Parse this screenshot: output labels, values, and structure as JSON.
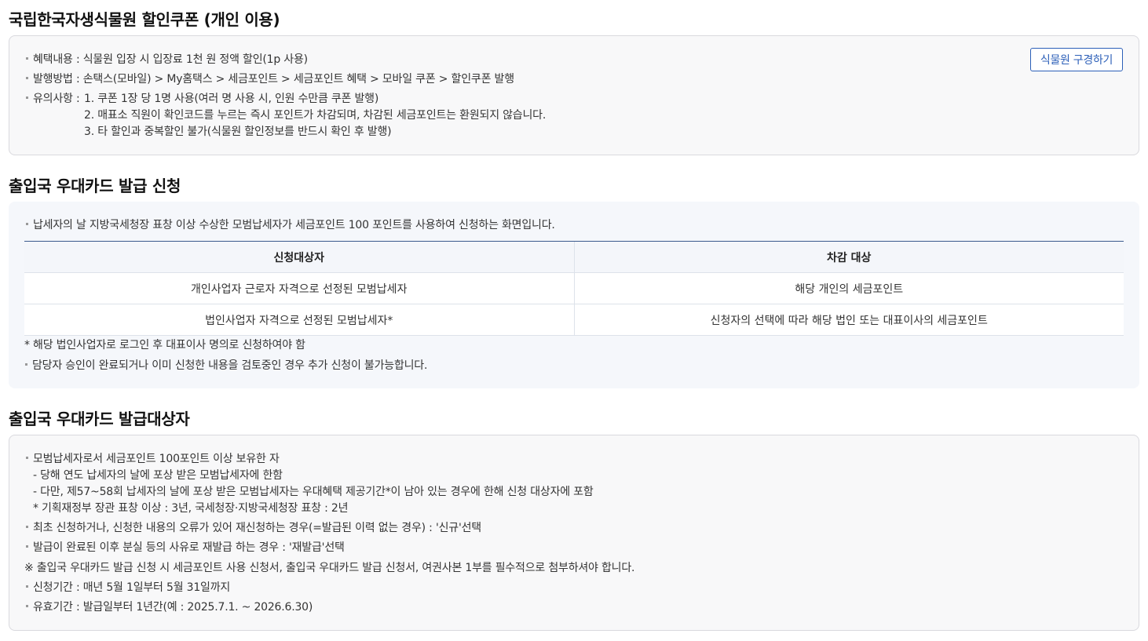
{
  "section1": {
    "title": "국립한국자생식물원 할인쿠폰 (개인 이용)",
    "button_label": "식물원 구경하기",
    "benefit": "혜택내용 : 식물원 입장 시 입장료 1천 원 정액 할인(1p 사용)",
    "issue_method": "발행방법 : 손택스(모바일) > My홈택스 > 세금포인트 > 세금포인트 혜택 > 모바일 쿠폰 > 할인쿠폰 발행",
    "caution_label": "유의사항 : ",
    "caution_items": [
      "1. 쿠폰 1장 당 1명 사용(여러 명 사용 시, 인원 수만큼 쿠폰 발행)",
      "2. 매표소 직원이 확인코드를 누르는 즉시 포인트가 차감되며, 차감된 세금포인트는 환원되지 않습니다.",
      "3. 타 할인과 중복할인 불가(식물원 할인정보를 반드시 확인 후 발행)"
    ]
  },
  "section2": {
    "title": "출입국 우대카드 발급 신청",
    "intro": "납세자의 날 지방국세청장 표창 이상 수상한 모범납세자가 세금포인트 100 포인트를 사용하여 신청하는 화면입니다.",
    "table": {
      "headers": [
        "신청대상자",
        "차감 대상"
      ],
      "rows": [
        [
          "개인사업자 근로자 자격으로 선정된 모범납세자",
          "해당 개인의 세금포인트"
        ],
        [
          "법인사업자 자격으로 선정된 모범납세자*",
          "신청자의 선택에 따라 해당 법인 또는 대표이사의 세금포인트"
        ]
      ]
    },
    "footnote": "* 해당 법인사업자로 로그인 후 대표이사 명의로 신청하여야 함",
    "note": "담당자 승인이 완료되거나 이미 신청한 내용을 검토중인 경우 추가 신청이 불가능합니다."
  },
  "section3": {
    "title": "출입국 우대카드 발급대상자",
    "items": [
      "모범납세자로서 세금포인트 100포인트 이상 보유한 자",
      "- 당해 연도 납세자의 날에 포상 받은 모범납세자에 한함",
      "- 다만, 제57~58회 납세자의 날에 포상 받은 모범납세자는 우대혜택 제공기간*이 남아 있는 경우에 한해 신청 대상자에 포함",
      "* 기획재정부 장관 표창 이상 : 3년, 국세청장·지방국세청장 표창 : 2년",
      "최초 신청하거나, 신청한 내용의 오류가 있어 재신청하는 경우(=발급된 이력 없는 경우) : '신규'선택",
      "발급이 완료된 이후 분실 등의 사유로 재발급 하는 경우 : '재발급'선택",
      "※ 출입국 우대카드 발급 신청 시 세금포인트 사용 신청서, 출입국 우대카드 발급 신청서, 여권사본 1부를 필수적으로 첨부하셔야 합니다.",
      "신청기간 : 매년 5월 1일부터 5월 31일까지",
      "유효기간 : 발급일부터 1년간(예 : 2025.7.1. ~ 2026.6.30)"
    ]
  }
}
